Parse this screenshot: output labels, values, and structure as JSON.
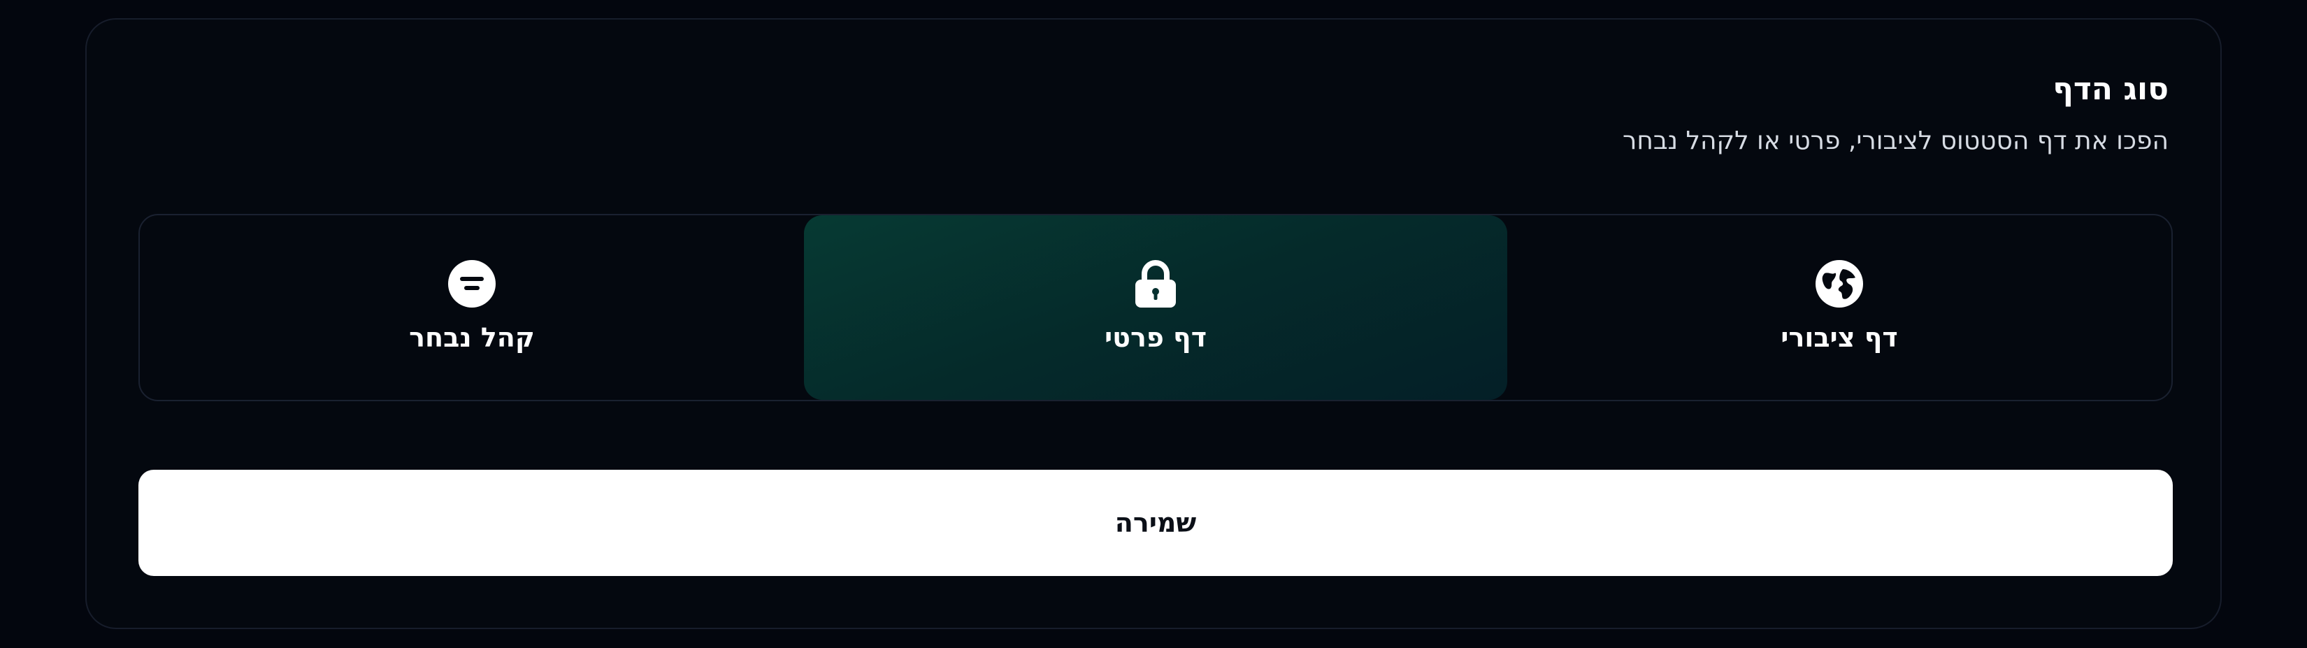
{
  "section": {
    "title": "סוג הדף",
    "subtitle": "הפכו את דף הסטטוס לציבורי, פרטי או לקהל נבחר"
  },
  "options": [
    {
      "label": "קהל נבחר",
      "icon": "filter-circle-icon",
      "selected": false
    },
    {
      "label": "דף פרטי",
      "icon": "lock-icon",
      "selected": true
    },
    {
      "label": "דף ציבורי",
      "icon": "globe-icon",
      "selected": false
    }
  ],
  "actions": {
    "save_label": "שמירה"
  },
  "colors": {
    "background": "#03060e",
    "selected_accent": "#063a33",
    "button_bg": "#ffffff"
  }
}
